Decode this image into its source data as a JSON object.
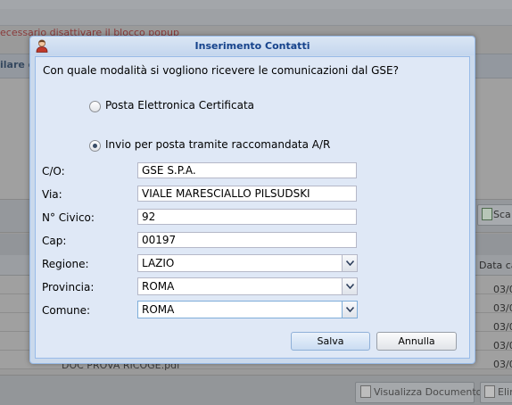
{
  "background": {
    "warning_text": "ecessario disattivare il blocco popup",
    "panel_header_text": "ilare e",
    "scan_button_label": "Sca",
    "grid_column_header": "Data ca",
    "row_dates": [
      "03/0",
      "03/0",
      "03/0",
      "03/0",
      "03/0"
    ],
    "row_file_name": "DOC PROVA RICOGE.pdf",
    "view_document_button_label": "Visualizza Documento",
    "delete_button_label": "Elim"
  },
  "dialog": {
    "title": "Inserimento Contatti",
    "question": "Con quale modalità si vogliono ricevere le comunicazioni dal GSE?",
    "options": [
      {
        "label": "Posta Elettronica Certificata",
        "checked": false
      },
      {
        "label": "Invio per posta tramite raccomandata A/R",
        "checked": true
      }
    ],
    "fields": {
      "co": {
        "label": "C/O:",
        "value": "GSE S.P.A."
      },
      "via": {
        "label": "Via:",
        "value": "VIALE MARESCIALLO PILSUDSKI"
      },
      "civico": {
        "label": "N° Civico:",
        "value": "92"
      },
      "cap": {
        "label": "Cap:",
        "value": "00197"
      },
      "regione": {
        "label": "Regione:",
        "value": "LAZIO"
      },
      "provincia": {
        "label": "Provincia:",
        "value": "ROMA"
      },
      "comune": {
        "label": "Comune:",
        "value": "ROMA"
      }
    },
    "buttons": {
      "save": "Salva",
      "cancel": "Annulla"
    }
  },
  "colors": {
    "title_text": "#15428b",
    "dialog_body": "#dfe8f6",
    "dialog_border": "#99bbe8"
  }
}
